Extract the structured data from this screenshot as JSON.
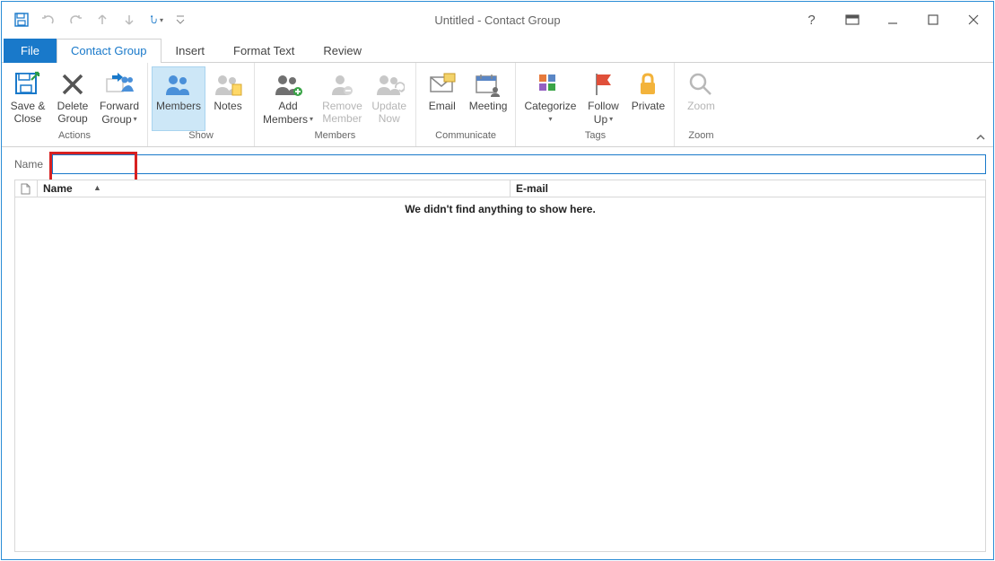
{
  "titlebar": {
    "title": "Untitled - Contact Group"
  },
  "tabs": {
    "file": "File",
    "contact_group": "Contact Group",
    "insert": "Insert",
    "format_text": "Format Text",
    "review": "Review"
  },
  "ribbon": {
    "actions": {
      "label": "Actions",
      "save_close_1": "Save &",
      "save_close_2": "Close",
      "delete_1": "Delete",
      "delete_2": "Group",
      "forward_1": "Forward",
      "forward_2": "Group"
    },
    "show": {
      "label": "Show",
      "members": "Members",
      "notes": "Notes"
    },
    "members": {
      "label": "Members",
      "add_1": "Add",
      "add_2": "Members",
      "remove_1": "Remove",
      "remove_2": "Member",
      "update_1": "Update",
      "update_2": "Now"
    },
    "communicate": {
      "label": "Communicate",
      "email": "Email",
      "meeting": "Meeting"
    },
    "tags": {
      "label": "Tags",
      "categorize": "Categorize",
      "follow_1": "Follow",
      "follow_2": "Up",
      "private": "Private"
    },
    "zoom": {
      "label": "Zoom",
      "zoom": "Zoom"
    }
  },
  "name_field": {
    "label": "Name",
    "value": ""
  },
  "members_list": {
    "col_name": "Name",
    "col_email": "E-mail",
    "empty_text": "We didn't find anything to show here."
  }
}
